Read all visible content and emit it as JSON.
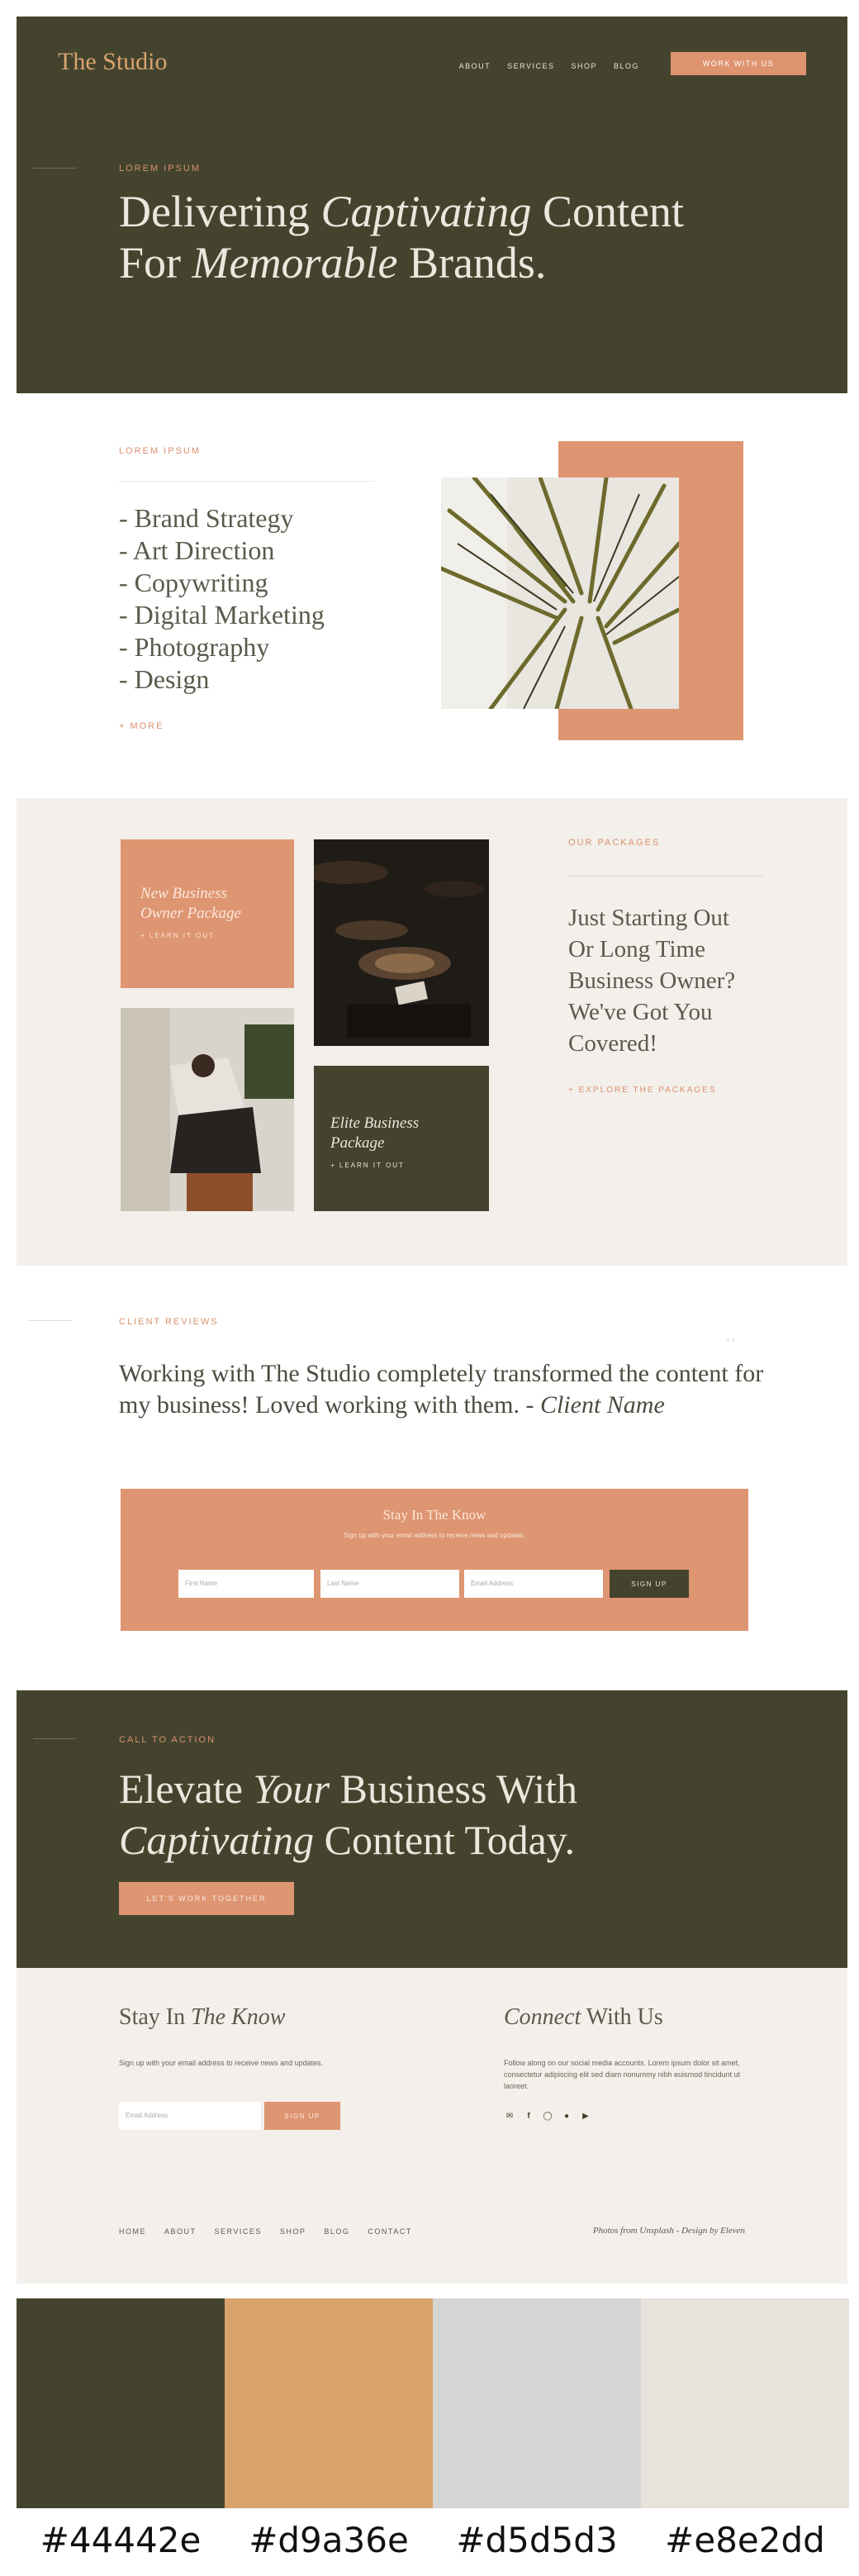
{
  "header": {
    "logo": "The Studio",
    "nav": [
      "ABOUT",
      "SERVICES",
      "SHOP",
      "BLOG"
    ],
    "cta_label": "WORK WITH US"
  },
  "hero": {
    "eyebrow": "LOREM IPSUM",
    "title_line1_pre": "Delivering ",
    "title_line1_em": "Captivating",
    "title_line1_post": " Content",
    "title_line2_pre": "For ",
    "title_line2_em": "Memorable",
    "title_line2_post": " Brands."
  },
  "services": {
    "eyebrow": "LOREM IPSUM",
    "items": [
      "- Brand Strategy",
      "- Art Direction",
      "- Copywriting",
      "- Digital Marketing",
      "- Photography",
      "- Design"
    ],
    "more_label": "+ MORE"
  },
  "packages": {
    "eyebrow": "OUR PACKAGES",
    "card1_title": "New Business Owner Package",
    "card1_sub": "+ LEARN IT OUT",
    "card2_title": "Elite Business Package",
    "card2_sub": "+ LEARN IT OUT",
    "headline": "Just Starting Out Or Long Time Business Owner? We've Got You Covered!",
    "explore_label": "+ EXPLORE THE PACKAGES"
  },
  "testimonial": {
    "eyebrow": "CLIENT REVIEWS",
    "quote": "Working with The Studio completely transformed the content for my business! Loved working with them. -",
    "client_name": "Client Name"
  },
  "signup": {
    "title": "Stay In The Know",
    "subtitle": "Sign up with your email address to receive news and updates.",
    "first_name_placeholder": "First Name",
    "last_name_placeholder": "Last Name",
    "email_placeholder": "Email Address",
    "button_label": "SIGN UP"
  },
  "cta": {
    "eyebrow": "CALL TO ACTION",
    "line1_pre": "Elevate ",
    "line1_em": "Your",
    "line1_post": " Business With",
    "line2_em": "Captivating",
    "line2_post": " Content Today.",
    "button_label": "LET'S WORK TOGETHER"
  },
  "footer": {
    "stay_pre": "Stay In ",
    "stay_em": "The Know",
    "stay_text": "Sign up with your email address to receive news and updates.",
    "email_placeholder": "Email Address",
    "signup_label": "SIGN UP",
    "connect_em": "Connect",
    "connect_post": " With Us",
    "connect_text": "Follow along on our social media accounts. Lorem ipsum dolor sit amet, consectetur adipiscing elit sed diam nonummy nibh euismod tincidunt ut laoreet.",
    "social_icons": [
      "email-icon",
      "facebook-icon",
      "instagram-icon",
      "pinterest-icon",
      "youtube-icon"
    ],
    "nav": [
      "HOME",
      "ABOUT",
      "SERVICES",
      "SHOP",
      "BLOG",
      "CONTACT"
    ],
    "credit": "Photos from Unsplash - Design by Eleven"
  },
  "palette": {
    "colors": [
      "#44442e",
      "#d9a36e",
      "#d5d5d3",
      "#e8e2dd"
    ],
    "labels": [
      "#44442e",
      "#d9a36e",
      "#d5d5d3",
      "#e8e2dd"
    ]
  }
}
